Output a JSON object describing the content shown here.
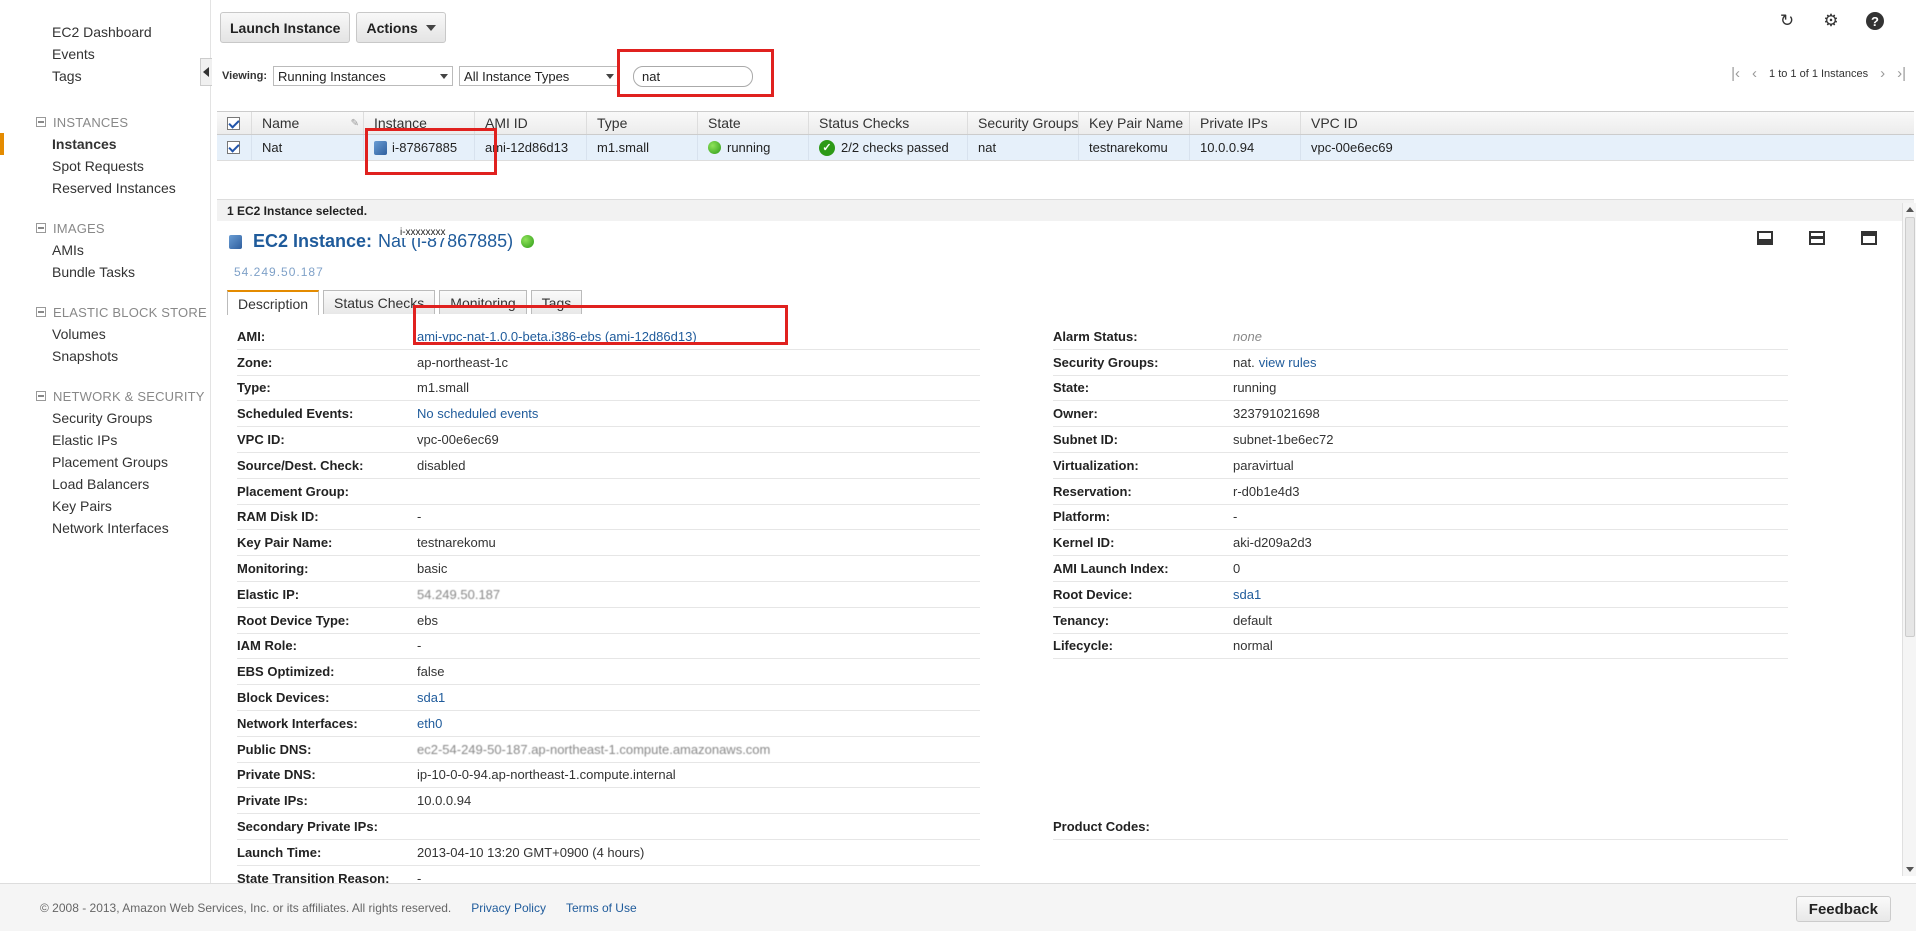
{
  "sidebar": {
    "top_links": [
      "EC2 Dashboard",
      "Events",
      "Tags"
    ],
    "sections": [
      {
        "header": "INSTANCES",
        "items": [
          "Instances",
          "Spot Requests",
          "Reserved Instances"
        ],
        "active": "Instances"
      },
      {
        "header": "IMAGES",
        "items": [
          "AMIs",
          "Bundle Tasks"
        ]
      },
      {
        "header": "ELASTIC BLOCK STORE",
        "items": [
          "Volumes",
          "Snapshots"
        ]
      },
      {
        "header": "NETWORK & SECURITY",
        "items": [
          "Security Groups",
          "Elastic IPs",
          "Placement Groups",
          "Load Balancers",
          "Key Pairs",
          "Network Interfaces"
        ]
      }
    ]
  },
  "toolbar": {
    "launch_label": "Launch Instance",
    "actions_label": "Actions",
    "icons": [
      "refresh-icon",
      "gear-icon",
      "help-icon"
    ]
  },
  "filter": {
    "viewing_label": "Viewing:",
    "state_filter": "Running Instances",
    "type_filter": "All Instance Types",
    "search_value": "nat",
    "pager_text": "1 to 1 of 1 Instances"
  },
  "grid": {
    "columns": [
      "Name",
      "Instance",
      "AMI ID",
      "Type",
      "State",
      "Status Checks",
      "Security Groups",
      "Key Pair Name",
      "Private IPs",
      "VPC ID"
    ],
    "rows": [
      {
        "name": "Nat",
        "instance": "i-87867885",
        "ami": "ami-12d86d13",
        "type": "m1.small",
        "state": "running",
        "status": "2/2 checks passed",
        "security_groups": "nat",
        "key_pair": "testnarekomu",
        "private_ip": "10.0.0.94",
        "vpc": "vpc-00e6ec69"
      }
    ]
  },
  "selected_text": "1 EC2 Instance selected.",
  "detail": {
    "title_label": "EC2 Instance:",
    "title_name": "Nat (i-87867885)",
    "overlay_small": "i-xxxxxxxx",
    "overlay_blurred": "54.249.50.187",
    "tabs": [
      "Description",
      "Status Checks",
      "Monitoring",
      "Tags"
    ],
    "left": [
      {
        "k": "AMI:",
        "v": "ami-vpc-nat-1.0.0-beta.i386-ebs (ami-12d86d13)",
        "style": "link"
      },
      {
        "k": "Zone:",
        "v": "ap-northeast-1c"
      },
      {
        "k": "Type:",
        "v": "m1.small"
      },
      {
        "k": "Scheduled Events:",
        "v": "No scheduled events",
        "style": "link"
      },
      {
        "k": "VPC ID:",
        "v": "vpc-00e6ec69"
      },
      {
        "k": "Source/Dest. Check:",
        "v": "disabled"
      },
      {
        "k": "Placement Group:",
        "v": ""
      },
      {
        "k": "RAM Disk ID:",
        "v": "-"
      },
      {
        "k": "Key Pair Name:",
        "v": "testnarekomu"
      },
      {
        "k": "Monitoring:",
        "v": "basic"
      },
      {
        "k": "Elastic IP:",
        "v": "54.249.50.187",
        "style": "blurred"
      },
      {
        "k": "Root Device Type:",
        "v": "ebs"
      },
      {
        "k": "IAM Role:",
        "v": "-"
      },
      {
        "k": "EBS Optimized:",
        "v": "false"
      },
      {
        "k": "Block Devices:",
        "v": "sda1",
        "style": "link"
      },
      {
        "k": "Network Interfaces:",
        "v": "eth0",
        "style": "link"
      },
      {
        "k": "Public DNS:",
        "v": "ec2-54-249-50-187.ap-northeast-1.compute.amazonaws.com",
        "style": "blurred"
      },
      {
        "k": "Private DNS:",
        "v": "ip-10-0-0-94.ap-northeast-1.compute.internal"
      },
      {
        "k": "Private IPs:",
        "v": "10.0.0.94"
      },
      {
        "k": "Secondary Private IPs:",
        "v": ""
      },
      {
        "k": "Launch Time:",
        "v": "2013-04-10 13:20 GMT+0900 (4 hours)"
      },
      {
        "k": "State Transition Reason:",
        "v": "-"
      }
    ],
    "right": [
      {
        "k": "Alarm Status:",
        "v": "none",
        "style": "muted"
      },
      {
        "k": "Security Groups:",
        "v": "nat.",
        "link": "view rules"
      },
      {
        "k": "State:",
        "v": "running"
      },
      {
        "k": "Owner:",
        "v": "323791021698"
      },
      {
        "k": "Subnet ID:",
        "v": "subnet-1be6ec72"
      },
      {
        "k": "Virtualization:",
        "v": "paravirtual"
      },
      {
        "k": "Reservation:",
        "v": "r-d0b1e4d3"
      },
      {
        "k": "Platform:",
        "v": "-"
      },
      {
        "k": "Kernel ID:",
        "v": "aki-d209a2d3"
      },
      {
        "k": "AMI Launch Index:",
        "v": "0"
      },
      {
        "k": "Root Device:",
        "v": "sda1",
        "style": "link"
      },
      {
        "k": "Tenancy:",
        "v": "default"
      },
      {
        "k": "Lifecycle:",
        "v": "normal"
      }
    ],
    "product_codes_label": "Product Codes:"
  },
  "footer": {
    "copyright": "© 2008 - 2013, Amazon Web Services, Inc. or its affiliates. All rights reserved.",
    "privacy": "Privacy Policy",
    "terms": "Terms of Use",
    "feedback": "Feedback"
  },
  "colors": {
    "accent": "#e48b00",
    "link": "#1f5b9b",
    "highlight": "#e0211f",
    "selected_row": "#e6f0fa"
  }
}
